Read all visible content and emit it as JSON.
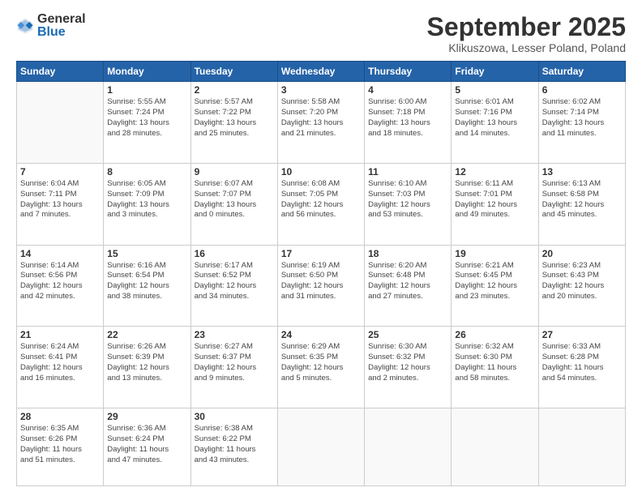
{
  "logo": {
    "general": "General",
    "blue": "Blue"
  },
  "title": "September 2025",
  "location": "Klikuszowa, Lesser Poland, Poland",
  "days_header": [
    "Sunday",
    "Monday",
    "Tuesday",
    "Wednesday",
    "Thursday",
    "Friday",
    "Saturday"
  ],
  "weeks": [
    [
      {
        "day": "",
        "detail": ""
      },
      {
        "day": "1",
        "detail": "Sunrise: 5:55 AM\nSunset: 7:24 PM\nDaylight: 13 hours\nand 28 minutes."
      },
      {
        "day": "2",
        "detail": "Sunrise: 5:57 AM\nSunset: 7:22 PM\nDaylight: 13 hours\nand 25 minutes."
      },
      {
        "day": "3",
        "detail": "Sunrise: 5:58 AM\nSunset: 7:20 PM\nDaylight: 13 hours\nand 21 minutes."
      },
      {
        "day": "4",
        "detail": "Sunrise: 6:00 AM\nSunset: 7:18 PM\nDaylight: 13 hours\nand 18 minutes."
      },
      {
        "day": "5",
        "detail": "Sunrise: 6:01 AM\nSunset: 7:16 PM\nDaylight: 13 hours\nand 14 minutes."
      },
      {
        "day": "6",
        "detail": "Sunrise: 6:02 AM\nSunset: 7:14 PM\nDaylight: 13 hours\nand 11 minutes."
      }
    ],
    [
      {
        "day": "7",
        "detail": "Sunrise: 6:04 AM\nSunset: 7:11 PM\nDaylight: 13 hours\nand 7 minutes."
      },
      {
        "day": "8",
        "detail": "Sunrise: 6:05 AM\nSunset: 7:09 PM\nDaylight: 13 hours\nand 3 minutes."
      },
      {
        "day": "9",
        "detail": "Sunrise: 6:07 AM\nSunset: 7:07 PM\nDaylight: 13 hours\nand 0 minutes."
      },
      {
        "day": "10",
        "detail": "Sunrise: 6:08 AM\nSunset: 7:05 PM\nDaylight: 12 hours\nand 56 minutes."
      },
      {
        "day": "11",
        "detail": "Sunrise: 6:10 AM\nSunset: 7:03 PM\nDaylight: 12 hours\nand 53 minutes."
      },
      {
        "day": "12",
        "detail": "Sunrise: 6:11 AM\nSunset: 7:01 PM\nDaylight: 12 hours\nand 49 minutes."
      },
      {
        "day": "13",
        "detail": "Sunrise: 6:13 AM\nSunset: 6:58 PM\nDaylight: 12 hours\nand 45 minutes."
      }
    ],
    [
      {
        "day": "14",
        "detail": "Sunrise: 6:14 AM\nSunset: 6:56 PM\nDaylight: 12 hours\nand 42 minutes."
      },
      {
        "day": "15",
        "detail": "Sunrise: 6:16 AM\nSunset: 6:54 PM\nDaylight: 12 hours\nand 38 minutes."
      },
      {
        "day": "16",
        "detail": "Sunrise: 6:17 AM\nSunset: 6:52 PM\nDaylight: 12 hours\nand 34 minutes."
      },
      {
        "day": "17",
        "detail": "Sunrise: 6:19 AM\nSunset: 6:50 PM\nDaylight: 12 hours\nand 31 minutes."
      },
      {
        "day": "18",
        "detail": "Sunrise: 6:20 AM\nSunset: 6:48 PM\nDaylight: 12 hours\nand 27 minutes."
      },
      {
        "day": "19",
        "detail": "Sunrise: 6:21 AM\nSunset: 6:45 PM\nDaylight: 12 hours\nand 23 minutes."
      },
      {
        "day": "20",
        "detail": "Sunrise: 6:23 AM\nSunset: 6:43 PM\nDaylight: 12 hours\nand 20 minutes."
      }
    ],
    [
      {
        "day": "21",
        "detail": "Sunrise: 6:24 AM\nSunset: 6:41 PM\nDaylight: 12 hours\nand 16 minutes."
      },
      {
        "day": "22",
        "detail": "Sunrise: 6:26 AM\nSunset: 6:39 PM\nDaylight: 12 hours\nand 13 minutes."
      },
      {
        "day": "23",
        "detail": "Sunrise: 6:27 AM\nSunset: 6:37 PM\nDaylight: 12 hours\nand 9 minutes."
      },
      {
        "day": "24",
        "detail": "Sunrise: 6:29 AM\nSunset: 6:35 PM\nDaylight: 12 hours\nand 5 minutes."
      },
      {
        "day": "25",
        "detail": "Sunrise: 6:30 AM\nSunset: 6:32 PM\nDaylight: 12 hours\nand 2 minutes."
      },
      {
        "day": "26",
        "detail": "Sunrise: 6:32 AM\nSunset: 6:30 PM\nDaylight: 11 hours\nand 58 minutes."
      },
      {
        "day": "27",
        "detail": "Sunrise: 6:33 AM\nSunset: 6:28 PM\nDaylight: 11 hours\nand 54 minutes."
      }
    ],
    [
      {
        "day": "28",
        "detail": "Sunrise: 6:35 AM\nSunset: 6:26 PM\nDaylight: 11 hours\nand 51 minutes."
      },
      {
        "day": "29",
        "detail": "Sunrise: 6:36 AM\nSunset: 6:24 PM\nDaylight: 11 hours\nand 47 minutes."
      },
      {
        "day": "30",
        "detail": "Sunrise: 6:38 AM\nSunset: 6:22 PM\nDaylight: 11 hours\nand 43 minutes."
      },
      {
        "day": "",
        "detail": ""
      },
      {
        "day": "",
        "detail": ""
      },
      {
        "day": "",
        "detail": ""
      },
      {
        "day": "",
        "detail": ""
      }
    ]
  ]
}
